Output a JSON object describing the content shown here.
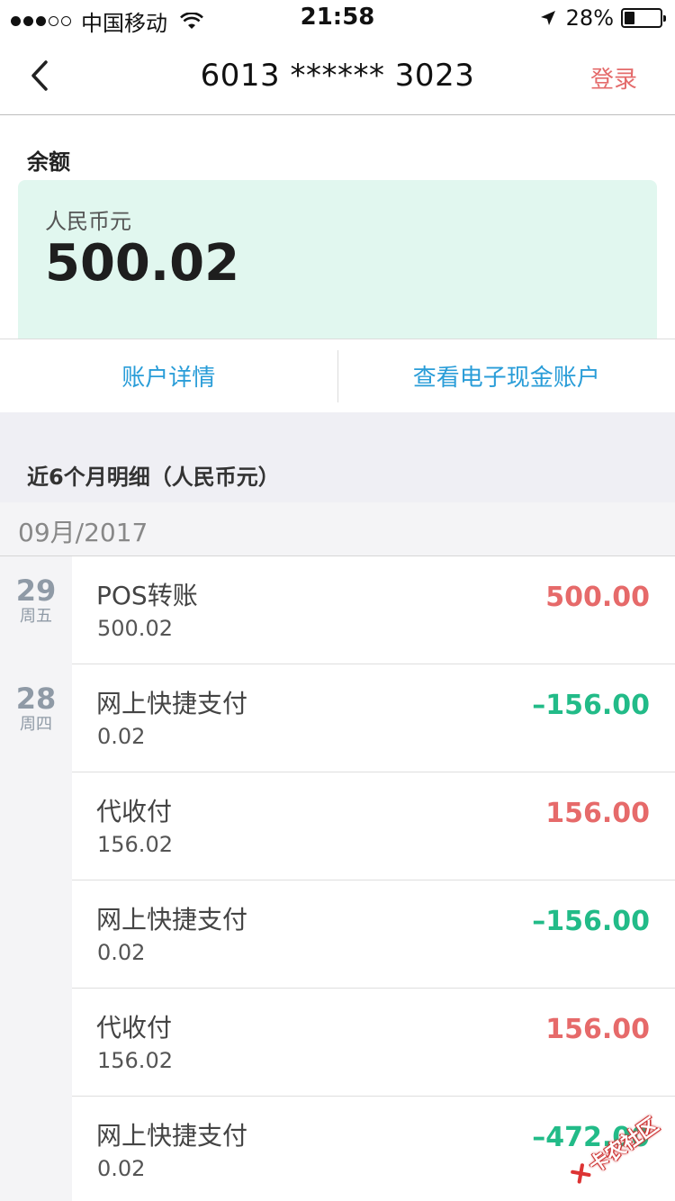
{
  "status_bar": {
    "carrier": "中国移动",
    "time": "21:58",
    "battery_text": "28%",
    "battery_level": 0.28
  },
  "nav": {
    "title": "6013 ****** 3023",
    "login_label": "登录"
  },
  "balance": {
    "label": "余额",
    "currency": "人民币元",
    "amount": "500.02"
  },
  "actions": {
    "account_details": "账户详情",
    "e_cash": "查看电子现金账户"
  },
  "details": {
    "title": "近6个月明细（人民币元）",
    "month": "09月/2017",
    "dates": [
      {
        "day": "29",
        "weekday": "周五"
      },
      {
        "day": "28",
        "weekday": "周四"
      }
    ],
    "transactions": [
      {
        "name": "POS转账",
        "balance": "500.02",
        "amount": "500.00",
        "direction": "in"
      },
      {
        "name": "网上快捷支付",
        "balance": "0.02",
        "amount": "–156.00",
        "direction": "out"
      },
      {
        "name": "代收付",
        "balance": "156.02",
        "amount": "156.00",
        "direction": "in"
      },
      {
        "name": "网上快捷支付",
        "balance": "0.02",
        "amount": "–156.00",
        "direction": "out"
      },
      {
        "name": "代收付",
        "balance": "156.02",
        "amount": "156.00",
        "direction": "in"
      },
      {
        "name": "网上快捷支付",
        "balance": "0.02",
        "amount": "–472.00",
        "direction": "out"
      }
    ]
  },
  "colors": {
    "income": "#e66a6a",
    "expense": "#22bb88",
    "link": "#2a9dd8",
    "balance_card": "#e1f7ef"
  },
  "watermark": {
    "text": "卡农社区"
  }
}
